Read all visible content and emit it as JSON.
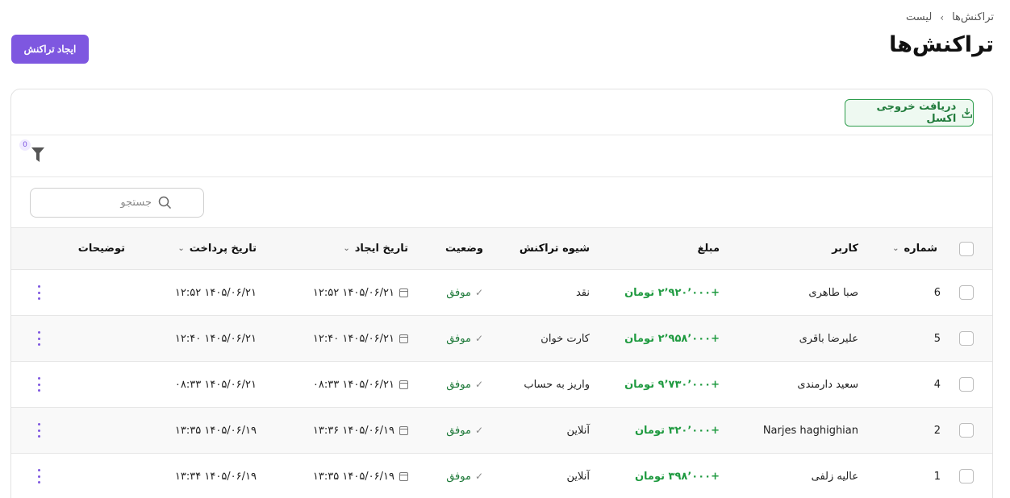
{
  "header": {
    "breadcrumb": [
      "تراکنش‌ها",
      "لیست"
    ],
    "title": "تراکنش‌ها",
    "create_button": "ایجاد تراکنش"
  },
  "toolbar": {
    "excel_button": "دریافت خروجی اکسل",
    "filter_count": "0",
    "search_placeholder": "جستجو"
  },
  "table": {
    "headers": {
      "number": "شماره",
      "user": "کاربر",
      "amount": "مبلغ",
      "method": "شیوه تراکنش",
      "status": "وضعیت",
      "created": "تاریخ ایجاد",
      "paid": "تاریخ پرداخت",
      "notes": "توضیحات"
    },
    "rows": [
      {
        "number": "6",
        "user": "صبا طاهری",
        "amount": "+۲٬۹۲۰٬۰۰۰ تومان",
        "method": "نقد",
        "status": "موفق",
        "created": "۱۴۰۵/۰۶/۲۱ ۱۲:۵۲",
        "paid": "۱۴۰۵/۰۶/۲۱ ۱۲:۵۲"
      },
      {
        "number": "5",
        "user": "علیرضا باقری",
        "amount": "+۲٬۹۵۸٬۰۰۰ تومان",
        "method": "کارت خوان",
        "status": "موفق",
        "created": "۱۴۰۵/۰۶/۲۱ ۱۲:۴۰",
        "paid": "۱۴۰۵/۰۶/۲۱ ۱۲:۴۰"
      },
      {
        "number": "4",
        "user": "سعید دارمندی",
        "amount": "+۹٬۷۳۰٬۰۰۰ تومان",
        "method": "واریز به حساب",
        "status": "موفق",
        "created": "۱۴۰۵/۰۶/۲۱ ۰۸:۳۳",
        "paid": "۱۴۰۵/۰۶/۲۱ ۰۸:۳۳"
      },
      {
        "number": "2",
        "user": "Narjes haghighian",
        "amount": "+۳۲۰٬۰۰۰ تومان",
        "method": "آنلاین",
        "status": "موفق",
        "created": "۱۴۰۵/۰۶/۱۹ ۱۳:۳۶",
        "paid": "۱۴۰۵/۰۶/۱۹ ۱۳:۳۵"
      },
      {
        "number": "1",
        "user": "عالیه زلفی",
        "amount": "+۳۹۸٬۰۰۰ تومان",
        "method": "آنلاین",
        "status": "موفق",
        "created": "۱۴۰۵/۰۶/۱۹ ۱۳:۳۵",
        "paid": "۱۴۰۵/۰۶/۱۹ ۱۳:۳۴"
      }
    ]
  },
  "colors": {
    "accent": "#7e57e0",
    "success": "#1f9a40"
  }
}
